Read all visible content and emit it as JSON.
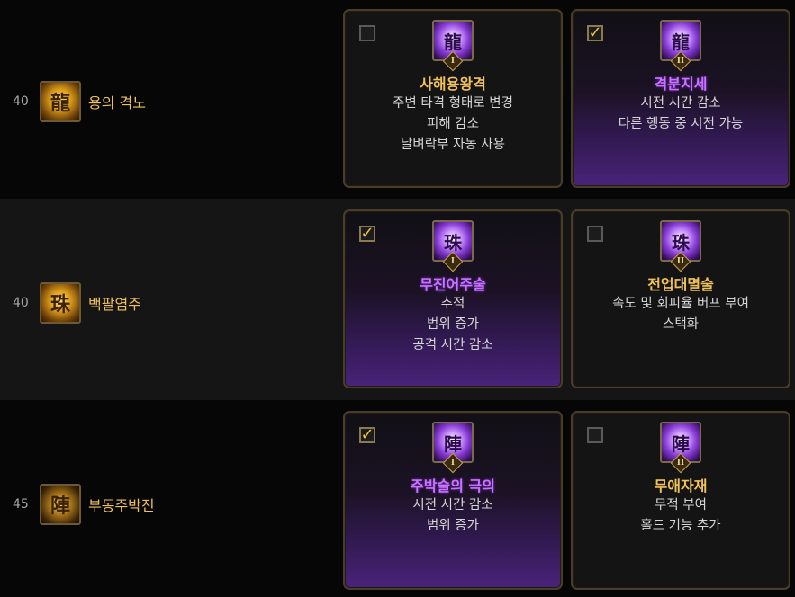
{
  "rows": [
    {
      "level": "40",
      "skill": {
        "name": "용의 격노",
        "icon": "golden-dragon-icon"
      },
      "options": [
        {
          "name": "사해용왕격",
          "rank": "I",
          "checked": false,
          "icon": "purple-dragon-icon",
          "desc": [
            "주변 타격 형태로 변경",
            "피해 감소",
            "날벼락부 자동 사용"
          ]
        },
        {
          "name": "격분지세",
          "rank": "II",
          "checked": true,
          "icon": "purple-dragon-icon",
          "desc": [
            "시전 시간 감소",
            "다른 행동 중 시전 가능"
          ]
        }
      ]
    },
    {
      "level": "40",
      "skill": {
        "name": "백팔염주",
        "icon": "golden-beads-icon"
      },
      "options": [
        {
          "name": "무진어주술",
          "rank": "I",
          "checked": true,
          "icon": "purple-beads-icon",
          "desc": [
            "추적",
            "범위 증가",
            "공격 시간 감소"
          ]
        },
        {
          "name": "전업대멸술",
          "rank": "II",
          "checked": false,
          "icon": "purple-beads-icon",
          "desc": [
            "속도 및 회피율 버프 부여",
            "스택화"
          ]
        }
      ]
    },
    {
      "level": "45",
      "skill": {
        "name": "부동주박진",
        "icon": "golden-seal-icon"
      },
      "options": [
        {
          "name": "주박술의 극의",
          "rank": "I",
          "checked": true,
          "icon": "purple-seal-icon",
          "desc": [
            "시전 시간 감소",
            "범위 증가"
          ]
        },
        {
          "name": "무애자재",
          "rank": "II",
          "checked": false,
          "icon": "purple-seal-icon",
          "desc": [
            "무적 부여",
            "홀드 기능 추가"
          ]
        }
      ]
    }
  ],
  "checkmark": "✓",
  "colors": {
    "accent_gold": "#f2c25a",
    "selected_name": "#c874ff",
    "selected_bg": "#4a237a"
  }
}
